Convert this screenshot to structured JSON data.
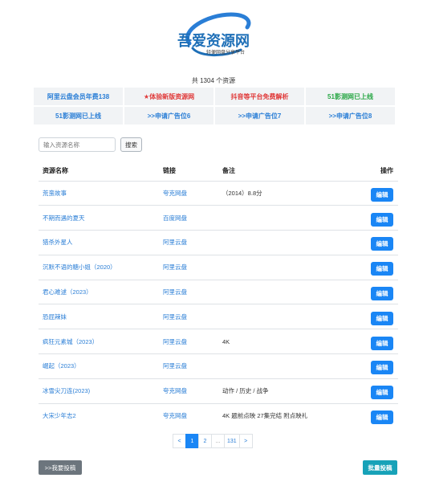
{
  "logo": {
    "title": "吾爱资源网",
    "subtitle": "轻便网盘分享平台",
    "colors": {
      "primary": "#1e6fb7",
      "arc": "#2a7ed6"
    }
  },
  "total_text": "共 1304 个资源",
  "ads": {
    "row1": [
      {
        "label": "阿里云盘会员年费138",
        "color": "#2a7ed6"
      },
      {
        "label": "★体验新版资源网",
        "color": "#e03a3a"
      },
      {
        "label": "抖音等平台免费解析",
        "color": "#e03a3a"
      },
      {
        "label": "51影测网已上线",
        "color": "#28a745"
      }
    ],
    "row2": [
      {
        "label": "51影测网已上线",
        "color": "#2a7ed6"
      },
      {
        "label": ">>申请广告位6",
        "color": "#2a7ed6"
      },
      {
        "label": ">>申请广告位7",
        "color": "#2a7ed6"
      },
      {
        "label": ">>申请广告位8",
        "color": "#2a7ed6"
      }
    ]
  },
  "search": {
    "placeholder": "输入资源名称",
    "button": "搜索"
  },
  "table": {
    "headers": {
      "name": "资源名称",
      "link": "链接",
      "note": "备注",
      "op": "操作"
    },
    "edit_label": "编辑",
    "rows": [
      {
        "name": "荒蛮故事",
        "link": "夸克网盘",
        "note": "（2014）8.8分"
      },
      {
        "name": "不期而遇的夏天",
        "link": "百度网盘",
        "note": ""
      },
      {
        "name": "猎杀外星人",
        "link": "阿里云盘",
        "note": ""
      },
      {
        "name": "沉默不语的糖小姐（2020）",
        "link": "阿里云盘",
        "note": ""
      },
      {
        "name": "君心难逑（2023）",
        "link": "阿里云盘",
        "note": ""
      },
      {
        "name": "恐屁辣妹",
        "link": "阿里云盘",
        "note": ""
      },
      {
        "name": "疯狂元素城（2023）",
        "link": "阿里云盘",
        "note": "4K"
      },
      {
        "name": "崛起（2023）",
        "link": "阿里云盘",
        "note": ""
      },
      {
        "name": "冰雪尖刀连(2023)",
        "link": "夸克网盘",
        "note": "动作 / 历史 / 战争"
      },
      {
        "name": "大宋少年志2",
        "link": "夸克网盘",
        "note": "4K 题前点映 27集完结 附点映礼"
      }
    ]
  },
  "pager": {
    "prev": "<",
    "pages": [
      "1",
      "2",
      "...",
      "131"
    ],
    "next": ">",
    "active": "1"
  },
  "footer": {
    "submit": ">>我要投稿",
    "batch": "批量投稿"
  }
}
